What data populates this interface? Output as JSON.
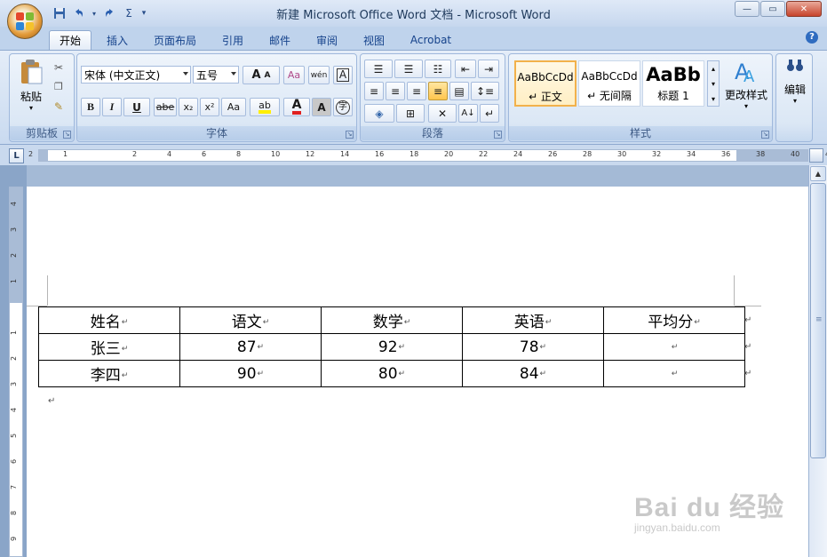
{
  "window": {
    "title": "新建 Microsoft Office Word 文档 - Microsoft Word",
    "controls": {
      "minimize": "—",
      "maximize": "▭",
      "close": "✕"
    }
  },
  "quick_access": {
    "save_icon": "save-icon",
    "undo_icon": "undo-icon",
    "redo_icon": "redo-icon",
    "sigma": "Σ",
    "customize": "▾"
  },
  "tabs": [
    {
      "label": "开始",
      "active": true
    },
    {
      "label": "插入"
    },
    {
      "label": "页面布局"
    },
    {
      "label": "引用"
    },
    {
      "label": "邮件"
    },
    {
      "label": "审阅"
    },
    {
      "label": "视图"
    },
    {
      "label": "Acrobat"
    }
  ],
  "help": "?",
  "ribbon": {
    "clipboard": {
      "label": "剪贴板",
      "paste": "粘贴"
    },
    "font": {
      "label": "字体",
      "font_name": "宋体 (中文正文)",
      "font_size": "五号",
      "grow": "A",
      "shrink": "A",
      "pinyin": "wén",
      "border_char": "A",
      "bold": "B",
      "italic": "I",
      "underline": "U",
      "strike": "abe",
      "subscript": "x₂",
      "superscript": "x²",
      "case": "Aa",
      "highlight": "ab",
      "color": "A",
      "shade": "A",
      "enclose": "字"
    },
    "paragraph": {
      "label": "段落"
    },
    "styles": {
      "label": "样式",
      "items": [
        {
          "sample": "AaBbCcDd",
          "name": "↵ 正文"
        },
        {
          "sample": "AaBbCcDd",
          "name": "↵ 无间隔"
        },
        {
          "sample": "AaBb",
          "name": "标题 1"
        }
      ],
      "change": "更改样式"
    },
    "editing": {
      "label": "编辑"
    }
  },
  "ruler": {
    "corner": "L",
    "numbers": [
      "2",
      "1",
      "",
      "2",
      "4",
      "6",
      "8",
      "10",
      "12",
      "14",
      "16",
      "18",
      "20",
      "22",
      "24",
      "26",
      "28",
      "30",
      "32",
      "34",
      "36",
      "38",
      "40",
      "42"
    ]
  },
  "vruler": {
    "numbers": [
      "4",
      "3",
      "2",
      "1",
      "",
      "1",
      "2",
      "3",
      "4",
      "5",
      "6",
      "7",
      "8",
      "9"
    ]
  },
  "document": {
    "paragraph_mark": "↵",
    "table": {
      "headers": [
        "姓名",
        "语文",
        "数学",
        "英语",
        "平均分"
      ],
      "rows": [
        [
          "张三",
          "87",
          "92",
          "78",
          ""
        ],
        [
          "李四",
          "90",
          "80",
          "84",
          ""
        ]
      ]
    }
  },
  "watermark": {
    "brand": "Bai du 经验",
    "url": "jingyan.baidu.com"
  }
}
